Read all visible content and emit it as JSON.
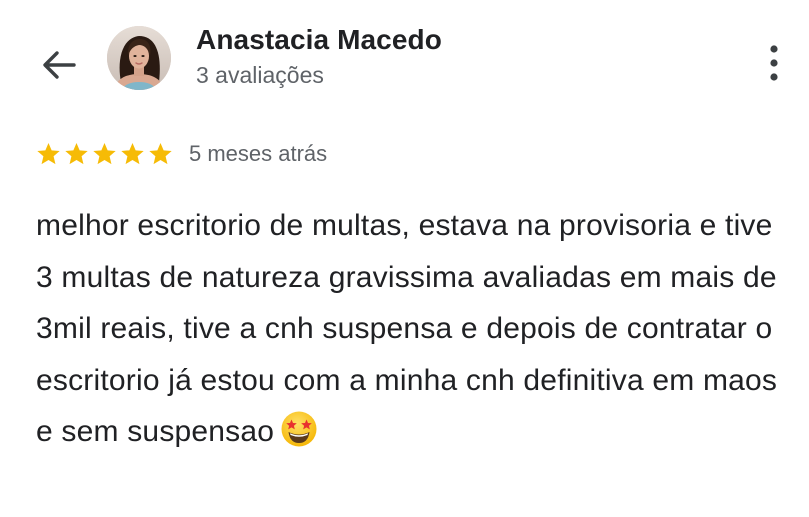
{
  "header": {
    "back_icon": "arrow-left-icon",
    "user_name": "Anastacia Macedo",
    "user_reviews": "3 avaliações",
    "more_icon": "more-vertical-icon"
  },
  "review": {
    "rating": 5,
    "rating_max": 5,
    "star_color": "#F6BB06",
    "date": "5 meses atrás",
    "text": "melhor escritorio de multas, estava na provisoria e tive 3 multas de natureza gravissima avaliadas em mais de 3mil reais, tive a cnh suspensa e depois de contratar o escritorio já estou com a minha cnh definitiva em maos e sem suspensao",
    "emoji": "star-struck-emoji"
  },
  "colors": {
    "text_primary": "#202124",
    "text_secondary": "#5f6368",
    "icon": "#3c4043"
  }
}
